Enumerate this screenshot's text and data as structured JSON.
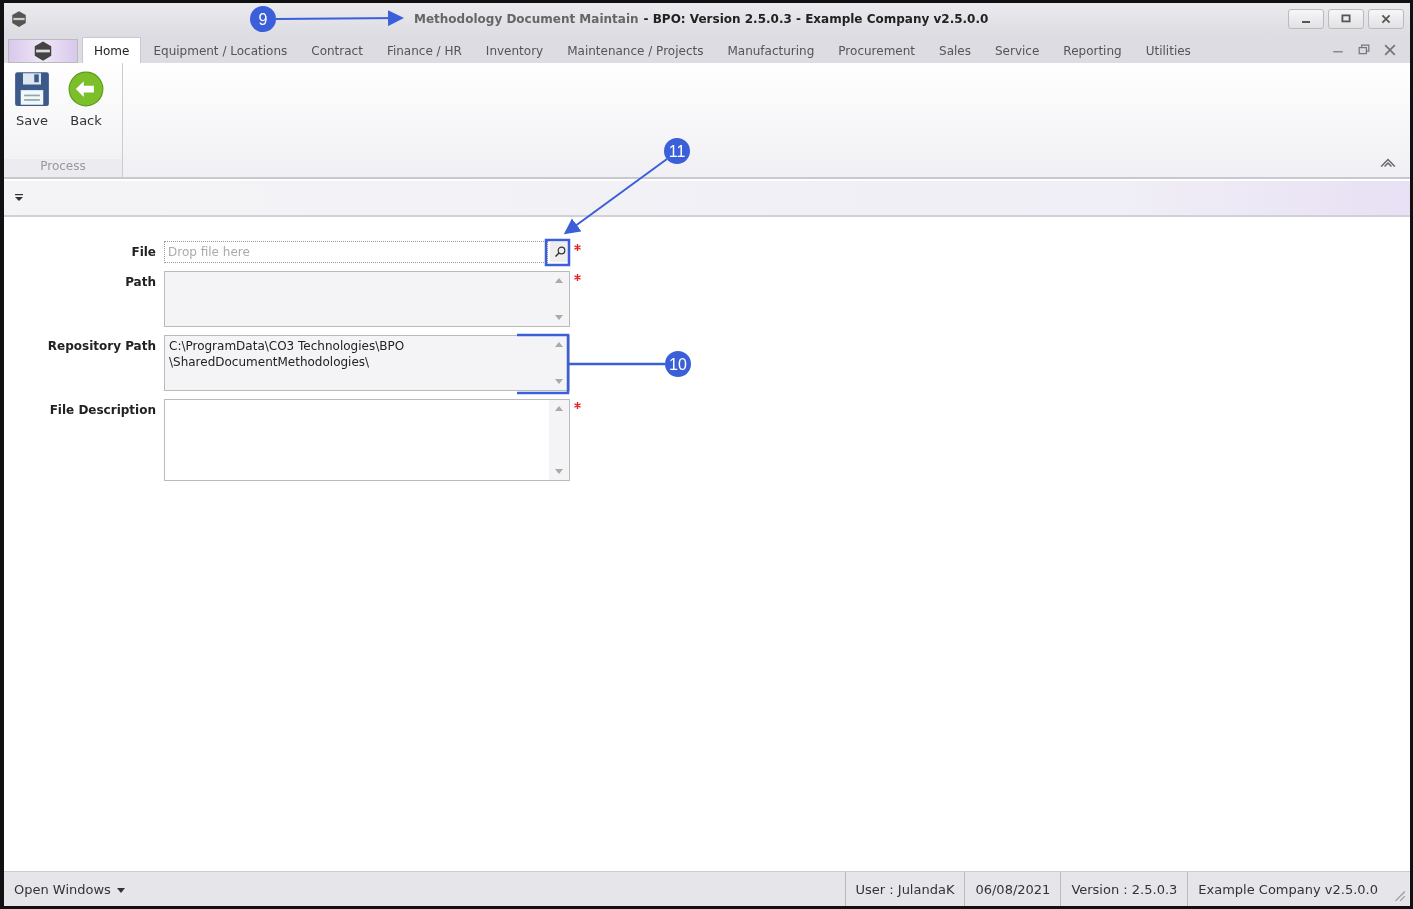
{
  "window": {
    "title_document": "Methodology Document Maintain",
    "title_app": "- BPO: Version 2.5.0.3 - Example Company v2.5.0.0"
  },
  "tabs": [
    {
      "label": "Home",
      "selected": true
    },
    {
      "label": "Equipment / Locations",
      "selected": false
    },
    {
      "label": "Contract",
      "selected": false
    },
    {
      "label": "Finance / HR",
      "selected": false
    },
    {
      "label": "Inventory",
      "selected": false
    },
    {
      "label": "Maintenance / Projects",
      "selected": false
    },
    {
      "label": "Manufacturing",
      "selected": false
    },
    {
      "label": "Procurement",
      "selected": false
    },
    {
      "label": "Sales",
      "selected": false
    },
    {
      "label": "Service",
      "selected": false
    },
    {
      "label": "Reporting",
      "selected": false
    },
    {
      "label": "Utilities",
      "selected": false
    }
  ],
  "ribbon": {
    "buttons": [
      {
        "label": "Save",
        "kind": "save"
      },
      {
        "label": "Back",
        "kind": "back"
      }
    ],
    "group": "Process"
  },
  "form": [
    {
      "label": "File",
      "kind": "file",
      "placeholder": "Drop file here",
      "required": true
    },
    {
      "label": "Path",
      "kind": "memo",
      "required": true
    },
    {
      "label": "Repository Path",
      "kind": "memo",
      "lines": [
        "C:\\ProgramData\\CO3 Technologies\\BPO",
        "\\SharedDocumentMethodologies\\"
      ],
      "required": false
    },
    {
      "label": "File Description",
      "kind": "memo-tall",
      "required": true
    }
  ],
  "annotations": [
    "9",
    "10",
    "11"
  ],
  "status_bar": {
    "open_windows": "Open Windows",
    "items": [
      "User : JulandaK",
      "06/08/2021",
      "Version : 2.5.0.3",
      "Example Company v2.5.0.0"
    ]
  }
}
